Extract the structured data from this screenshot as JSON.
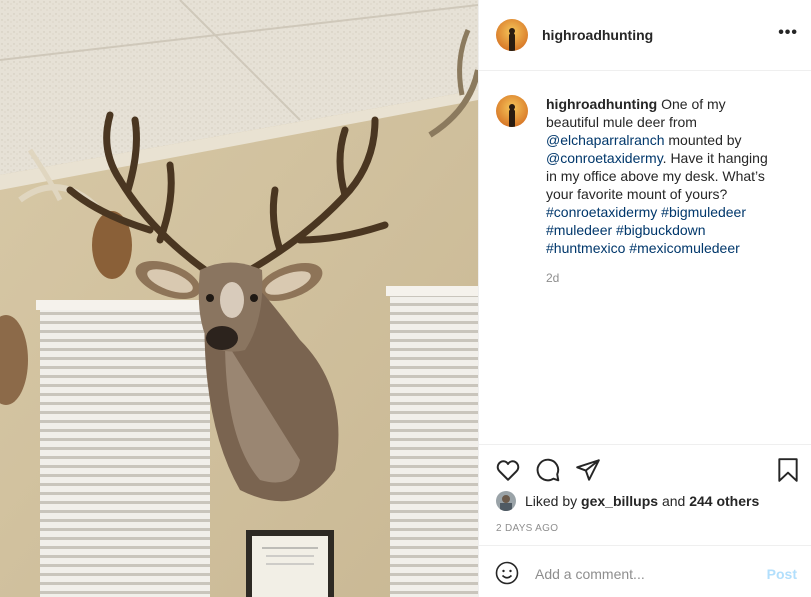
{
  "post": {
    "username": "highroadhunting",
    "more_icon": "more-horizontal-icon",
    "caption": {
      "username": "highroadhunting",
      "text_1": " One of my beautiful mule deer from ",
      "mention_1": "@elchaparralranch",
      "text_2": " mounted by ",
      "mention_2": "@conroetaxidermy",
      "text_3": ". Have it hanging in my office above my desk. What’s your favorite mount of yours? ",
      "hashtags": [
        "#conroetaxidermy",
        "#bigmuledeer",
        "#muledeer",
        "#bigbuckdown",
        "#huntmexico",
        "#mexicomuledeer"
      ]
    },
    "time_ago": "2d",
    "actions": {
      "like_icon": "heart-icon",
      "comment_icon": "comment-icon",
      "share_icon": "paper-plane-icon",
      "save_icon": "bookmark-icon"
    },
    "likes": {
      "prefix": "Liked by ",
      "user": "gex_billups",
      "middle": " and ",
      "count": "244 others"
    },
    "date": "2 DAYS AGO",
    "comment": {
      "placeholder": "Add a comment...",
      "post_label": "Post",
      "emoji_icon": "smiley-icon"
    }
  },
  "colors": {
    "link": "#00376b",
    "muted": "#8e8e8e",
    "post_disabled": "#b2dffc"
  }
}
